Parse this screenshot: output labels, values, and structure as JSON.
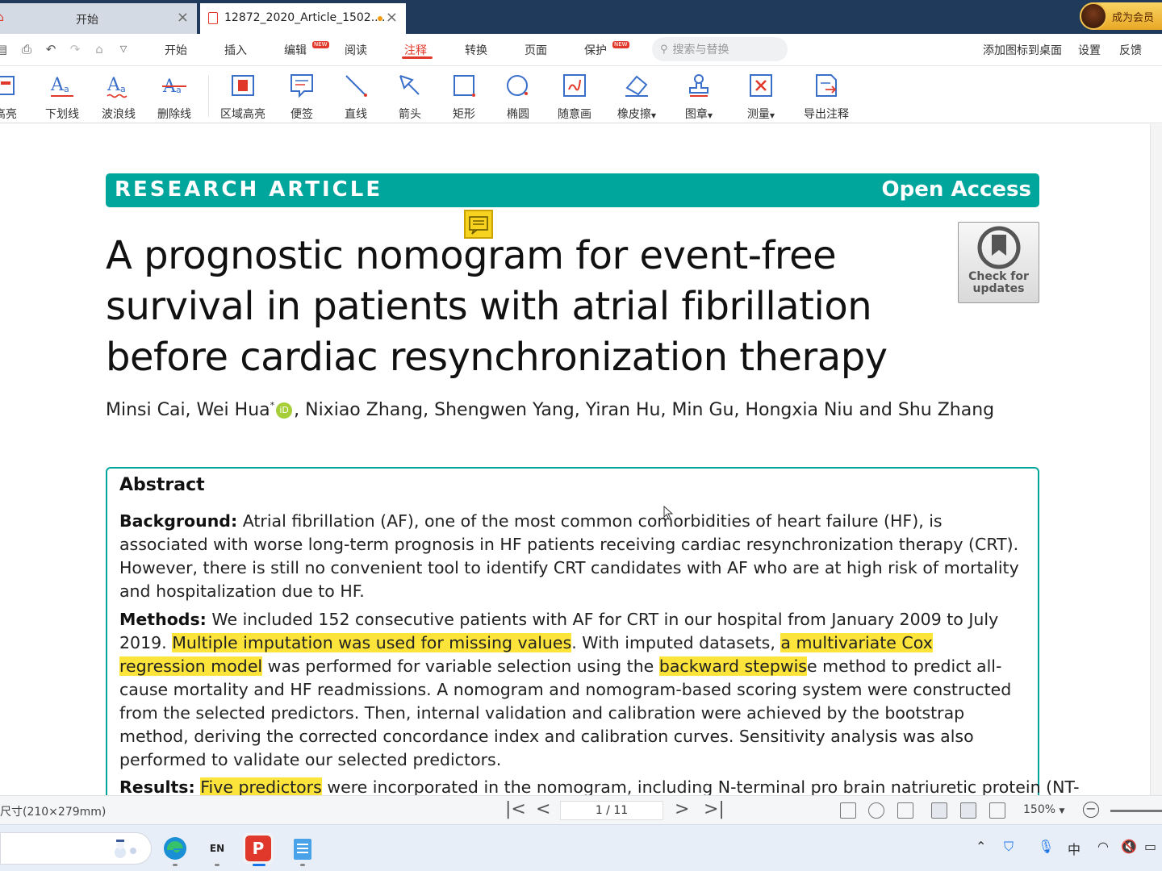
{
  "tabs": [
    {
      "label": "开始"
    },
    {
      "label": "12872_2020_Article_1502...."
    }
  ],
  "vip": {
    "label": "成为会员"
  },
  "menu": {
    "items": [
      "开始",
      "插入",
      "编辑",
      "阅读",
      "注释",
      "转换",
      "页面",
      "保护"
    ],
    "active": "注释",
    "new_badge": "NEW",
    "search_placeholder": "搜索与替换",
    "right_items": [
      "添加图标到桌面",
      "设置",
      "反馈"
    ]
  },
  "ribbon": {
    "tools": [
      "高亮",
      "下划线",
      "波浪线",
      "删除线",
      "区域高亮",
      "便签",
      "直线",
      "箭头",
      "矩形",
      "椭圆",
      "随意画",
      "橡皮擦",
      "图章",
      "测量",
      "导出注释"
    ]
  },
  "article": {
    "banner_left": "RESEARCH ARTICLE",
    "banner_right": "Open Access",
    "title_lines": [
      "A prognostic nomogram for event-free",
      "survival in patients with atrial fibrillation",
      "before cardiac resynchronization therapy"
    ],
    "check_updates": [
      "Check for",
      "updates"
    ],
    "authors_a": "Minsi Cai, Wei Hua",
    "authors_sup": "*",
    "authors_orcid": "iD",
    "authors_b": ", Nixiao Zhang, Shengwen Yang, Yiran Hu, Min Gu, Hongxia Niu and Shu Zhang",
    "abstract": {
      "heading": "Abstract",
      "background_label": "Background:",
      "background_text": "Atrial fibrillation (AF), one of the most common comorbidities of heart failure (HF), is associated with worse long-term prognosis in HF patients receiving cardiac resynchronization therapy (CRT). However, there is still no convenient tool to identify CRT candidates with AF who are at high risk of mortality and hospitalization due to HF.",
      "methods_label": "Methods:",
      "methods_t1": "We included 152 consecutive patients with AF for CRT in our hospital from January 2009 to July 2019.",
      "methods_h1": "Multiple imputation was used for missing values",
      "methods_t2": ". With imputed datasets,",
      "methods_h2": "a multivariate Cox regression model",
      "methods_t3": "was performed for variable selection using the",
      "methods_h3": "backward stepwis",
      "methods_t4": "e method to predict all-cause mortality and HF readmissions. A nomogram and nomogram-based scoring system were constructed from the selected predictors. Then, internal validation and calibration were achieved by the bootstrap method, deriving the corrected concordance index and calibration curves. Sensitivity analysis was also performed to validate our selected predictors.",
      "results_label": "Results:",
      "results_h1": "Five predictors",
      "results_t1": "were incorporated in the nomogram, including N-terminal pro brain natriuretic protein (NT-"
    }
  },
  "status": {
    "page_size": "尺寸(210×279mm)",
    "page": "1 / 11",
    "zoom": "150%"
  },
  "taskbar": {
    "ime": "EN",
    "tray_lang": "中"
  },
  "colors": {
    "accent_red": "#e0392b",
    "teal": "#00a69c",
    "highlight": "#fde43a",
    "tabbar": "#1f3a5a"
  }
}
